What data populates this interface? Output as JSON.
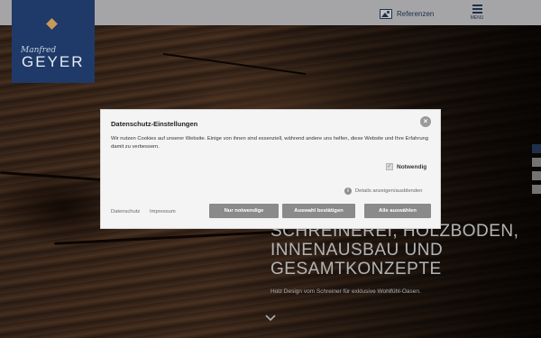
{
  "header": {
    "logo_script": "Manfred",
    "logo_text": "GEYER",
    "nav_reference_label": "Referenzen",
    "menu_label": "MENU"
  },
  "hero": {
    "title_lines": [
      "SCHREINEREI, HOLZBODEN,",
      "INNENAUSBAU UND",
      "GESAMTKONZEPTE"
    ],
    "subtitle": "Holz Design vom Schreiner für exklusive Wohlfühl-Oasen."
  },
  "cookie_dialog": {
    "title": "Datenschutz-Einstellungen",
    "close_label": "×",
    "description": "Wir nutzen Cookies auf unserer Website. Einige von ihnen sind essenziell, während andere uns helfen, diese Website und Ihre Erfahrung damit zu verbessern.",
    "necessary_label": "Notwendig",
    "necessary_checked": true,
    "details_label": "Details anzeigen/ausblenden",
    "privacy_link": "Datenschutz",
    "imprint_link": "Impressum",
    "buttons": {
      "only_necessary": "Nur notwendige",
      "confirm_selection": "Auswahl bestätigen",
      "accept_all": "Alle auswählen"
    }
  },
  "colors": {
    "brand_blue": "#1f3a68",
    "accent_gold": "#c79a5a",
    "button_gray": "#8a8a8a",
    "side_tab_blue": "#2a3f64",
    "side_tab_gray": "#9a9a9a"
  },
  "icons": {
    "references": "image-icon",
    "menu": "hamburger-icon",
    "scroll_down": "chevron-down-icon",
    "details": "info-icon",
    "close": "close-icon"
  }
}
